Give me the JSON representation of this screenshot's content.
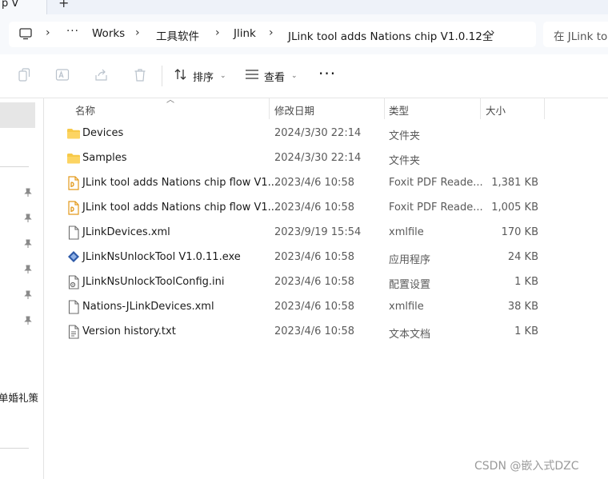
{
  "tab": {
    "title": "p V",
    "new_tab": "+"
  },
  "breadcrumb": {
    "more": "···",
    "items": [
      "Works",
      "工具软件",
      "Jlink",
      "JLink tool adds Nations chip V1.0.12全"
    ]
  },
  "search": {
    "placeholder": "在 JLink too"
  },
  "toolbar": {
    "sort_label": "排序",
    "view_label": "查看",
    "more": "···"
  },
  "nav": {
    "partial_text": "单婚礼策"
  },
  "columns": {
    "name": "名称",
    "date": "修改日期",
    "type": "类型",
    "size": "大小"
  },
  "files": [
    {
      "name": "Devices",
      "date": "2024/3/30 22:14",
      "type": "文件夹",
      "size": "",
      "icon": "folder-icon"
    },
    {
      "name": "Samples",
      "date": "2024/3/30 22:14",
      "type": "文件夹",
      "size": "",
      "icon": "folder-icon"
    },
    {
      "name": "JLink tool adds Nations chip flow V1....",
      "date": "2023/4/6 10:58",
      "type": "Foxit PDF Reade...",
      "size": "1,381 KB",
      "icon": "pdf-icon"
    },
    {
      "name": "JLink tool adds Nations chip flow V1....",
      "date": "2023/4/6 10:58",
      "type": "Foxit PDF Reade...",
      "size": "1,005 KB",
      "icon": "pdf-icon"
    },
    {
      "name": "JLinkDevices.xml",
      "date": "2023/9/19 15:54",
      "type": "xmlfile",
      "size": "170 KB",
      "icon": "file-icon"
    },
    {
      "name": "JLinkNsUnlockTool V1.0.11.exe",
      "date": "2023/4/6 10:58",
      "type": "应用程序",
      "size": "24 KB",
      "icon": "exe-icon"
    },
    {
      "name": "JLinkNsUnlockToolConfig.ini",
      "date": "2023/4/6 10:58",
      "type": "配置设置",
      "size": "1 KB",
      "icon": "ini-icon"
    },
    {
      "name": "Nations-JLinkDevices.xml",
      "date": "2023/4/6 10:58",
      "type": "xmlfile",
      "size": "38 KB",
      "icon": "file-icon"
    },
    {
      "name": "Version history.txt",
      "date": "2023/4/6 10:58",
      "type": "文本文档",
      "size": "1 KB",
      "icon": "file-icon"
    }
  ],
  "watermark": "CSDN @嵌入式DZC"
}
